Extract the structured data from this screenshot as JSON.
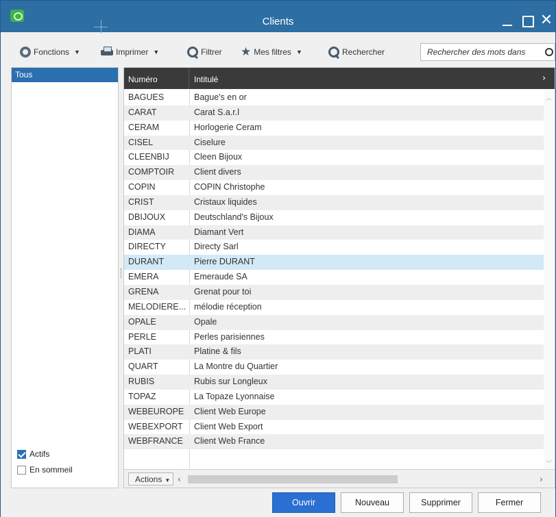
{
  "window": {
    "title": "Clients",
    "controls": {
      "minimize": "minimize",
      "maximize": "maximize",
      "close": "✕"
    }
  },
  "toolbar": {
    "fonctions": "Fonctions",
    "imprimer": "Imprimer",
    "filtrer": "Filtrer",
    "mes_filtres": "Mes filtres",
    "rechercher": "Rechercher",
    "search_placeholder": "Rechercher des mots dans"
  },
  "left_panel": {
    "selected_item": "Tous",
    "checkboxes": [
      {
        "label": "Actifs",
        "checked": true
      },
      {
        "label": "En sommeil",
        "checked": false
      }
    ]
  },
  "grid": {
    "columns": [
      "Numéro",
      "Intitulé"
    ],
    "selected_row": "DURANT",
    "rows": [
      {
        "numero": "BAGUES",
        "intitule": "Bague's en or"
      },
      {
        "numero": "CARAT",
        "intitule": "Carat S.a.r.l"
      },
      {
        "numero": "CERAM",
        "intitule": "Horlogerie Ceram"
      },
      {
        "numero": "CISEL",
        "intitule": "Ciselure"
      },
      {
        "numero": "CLEENBIJ",
        "intitule": "Cleen Bijoux"
      },
      {
        "numero": "COMPTOIR",
        "intitule": "Client divers"
      },
      {
        "numero": "COPIN",
        "intitule": "COPIN Christophe"
      },
      {
        "numero": "CRIST",
        "intitule": "Cristaux liquides"
      },
      {
        "numero": "DBIJOUX",
        "intitule": "Deutschland's Bijoux"
      },
      {
        "numero": "DIAMA",
        "intitule": "Diamant Vert"
      },
      {
        "numero": "DIRECTY",
        "intitule": "Directy Sarl"
      },
      {
        "numero": "DURANT",
        "intitule": "Pierre DURANT"
      },
      {
        "numero": "EMERA",
        "intitule": "Emeraude SA"
      },
      {
        "numero": "GRENA",
        "intitule": "Grenat pour toi"
      },
      {
        "numero": "MELODIERE...",
        "intitule": "mélodie réception"
      },
      {
        "numero": "OPALE",
        "intitule": "Opale"
      },
      {
        "numero": "PERLE",
        "intitule": "Perles parisiennes"
      },
      {
        "numero": "PLATI",
        "intitule": "Platine & fils"
      },
      {
        "numero": "QUART",
        "intitule": "La Montre du Quartier"
      },
      {
        "numero": "RUBIS",
        "intitule": "Rubis sur Longleux"
      },
      {
        "numero": "TOPAZ",
        "intitule": "La Topaze Lyonnaise"
      },
      {
        "numero": "WEBEUROPE",
        "intitule": "Client Web Europe"
      },
      {
        "numero": "WEBEXPORT",
        "intitule": "Client Web Export"
      },
      {
        "numero": "WEBFRANCE",
        "intitule": "Client Web France"
      }
    ],
    "footer": {
      "actions_label": "Actions"
    }
  },
  "buttons": {
    "ouvrir": "Ouvrir",
    "nouveau": "Nouveau",
    "supprimer": "Supprimer",
    "fermer": "Fermer"
  },
  "colors": {
    "titlebar": "#2d6ea3",
    "selection": "#2a6fb0",
    "selected_row": "#d3e9f5",
    "primary_button": "#2a6fd2",
    "grid_header": "#3a3a3a"
  }
}
